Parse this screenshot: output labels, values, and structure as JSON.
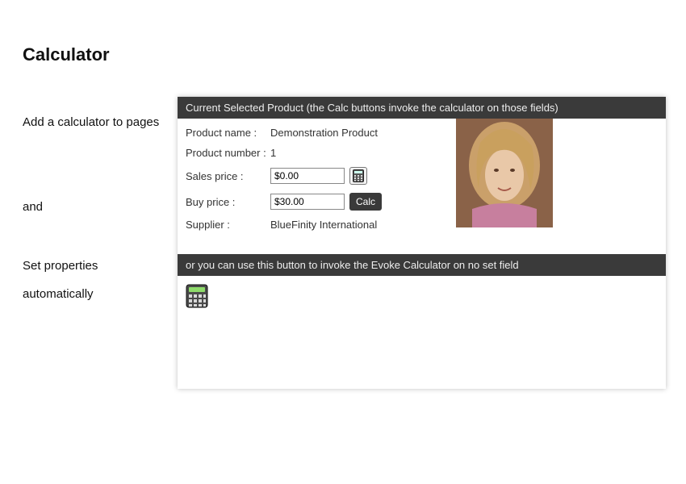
{
  "title": "Calculator",
  "side": {
    "line1": "Add a calculator to pages",
    "line2": "and",
    "line3": "Set properties automatically"
  },
  "panel": {
    "header1": "Current Selected Product (the Calc buttons invoke the calculator on those fields)",
    "header2": "or you can use this button to invoke the Evoke Calculator on no set field",
    "labels": {
      "product_name": "Product name :",
      "product_number": "Product number :",
      "sales_price": "Sales price :",
      "buy_price": "Buy price :",
      "supplier": "Supplier :"
    },
    "values": {
      "product_name": "Demonstration Product",
      "product_number": "1",
      "sales_price": "$0.00",
      "buy_price": "$30.00",
      "supplier": "BlueFinity International"
    },
    "calc_button_label": "Calc"
  }
}
